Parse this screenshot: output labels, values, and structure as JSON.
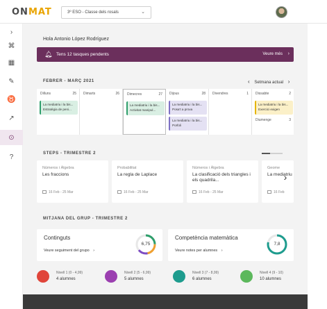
{
  "app": {
    "logo_left": "ON",
    "logo_accent": "MAT"
  },
  "header": {
    "class_selector": "3º ESO - Classe dels rosals",
    "chevron": "⌄"
  },
  "sidebar": {
    "items": [
      {
        "icon": "chevron-right-icon",
        "glyph": "›"
      },
      {
        "icon": "command-icon",
        "glyph": "⌘"
      },
      {
        "icon": "calendar-icon",
        "glyph": "▦"
      },
      {
        "icon": "pencil-icon",
        "glyph": "✎"
      },
      {
        "icon": "badge-icon",
        "glyph": "♉"
      },
      {
        "icon": "trend-icon",
        "glyph": "↗"
      },
      {
        "icon": "check-circle-icon",
        "glyph": "⊙"
      },
      {
        "icon": "help-icon",
        "glyph": "?"
      }
    ]
  },
  "main": {
    "greeting": "Hola Antonio López Rodríguez",
    "banner": {
      "text": "Tens 12 tasques pendents",
      "more": "Veure més",
      "arrow": "›",
      "bell": "🔔︎"
    },
    "calendar": {
      "title": "FEBRER - MARÇ 2021",
      "week_label": "Setmana actual",
      "prev": "‹",
      "next": "›",
      "days": [
        {
          "name": "Dilluns",
          "num": "25",
          "events": [
            {
              "line1": "La mediatriu i la bis...",
              "line2": "Estratègia de peni...",
              "color": "green"
            }
          ]
        },
        {
          "name": "Dimarts",
          "num": "26",
          "events": []
        },
        {
          "name": "Dimecres",
          "num": "27",
          "events": [
            {
              "line1": "La mediatriu i la bis...",
              "line2": "Activitat manipul...",
              "color": "green"
            }
          ]
        },
        {
          "name": "Dijous",
          "num": "28",
          "events": [
            {
              "line1": "La mediatriu i la bis...",
              "line2": "Posa't a prova",
              "color": "purple"
            },
            {
              "line1": "La mediatriu i la bis...",
              "line2": "Porfoli",
              "color": "purple"
            }
          ]
        },
        {
          "name": "Divendres",
          "num": "1",
          "events": []
        },
        {
          "name": "Dissabte",
          "num": "2",
          "events": [
            {
              "line1": "La mediatriu i la bis...",
              "line2": "Exercici exigen",
              "color": "yellow"
            }
          ],
          "sub_name": "Diumenge",
          "sub_num": "3"
        }
      ]
    },
    "steps": {
      "title": "STEPS - TRIMESTRE 2",
      "progress": 0.4,
      "next": "›",
      "cards": [
        {
          "category": "Números i Àlgebra",
          "title": "Les fraccions",
          "dates": "16 Feb - 25 Mar"
        },
        {
          "category": "Probabilitat",
          "title": "La regla de Laplace",
          "dates": "16 Feb - 25 Mar"
        },
        {
          "category": "Números i Àlgebra",
          "title": "La clasificació dels triangles i els quadrila...",
          "dates": "16 Feb - 25 Mar"
        },
        {
          "category": "Geome",
          "title": "La mediatriu",
          "dates": "16 Feb"
        }
      ]
    },
    "group": {
      "title": "MITJANA DEL GRUP - TRIMESTRE 2",
      "cards": [
        {
          "title": "Continguts",
          "link": "Veure seguiment del grupo",
          "arrow": "›",
          "value": "6,75",
          "score": 6.75
        },
        {
          "title": "Competència matemàtica",
          "link": "Veure notes per alumnes",
          "arrow": "›",
          "value": "7,8",
          "score": 7.8
        }
      ],
      "levels": [
        {
          "range": "Nivell 1 (0 - 4,99)",
          "count": "4 alumnes",
          "color": "#e0453a"
        },
        {
          "range": "Nivell 2 (5 - 6,99)",
          "count": "5 alumnes",
          "color": "#9b3fb0"
        },
        {
          "range": "Nivell 3 (7 - 8,99)",
          "count": "6 alumnes",
          "color": "#1e9c8e"
        },
        {
          "range": "Nivell 4 (9 - 10)",
          "count": "10 alumnes",
          "color": "#5cb85c"
        }
      ]
    }
  },
  "colors": {
    "banner": "#6b2f5c",
    "gauge_track": "#e8e8e8",
    "gauge_green": "#2e9e6b",
    "gauge_teal": "#1e9c8e",
    "gauge_orange": "#f0a030",
    "gauge_purple": "#7d4cc4"
  }
}
